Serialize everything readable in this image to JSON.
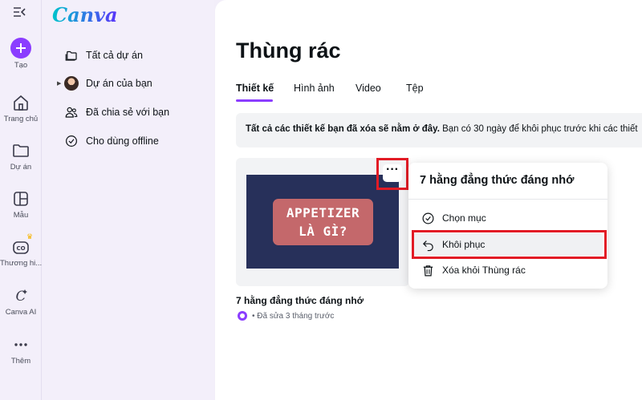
{
  "rail": {
    "items": [
      {
        "label": "Tạo",
        "icon": "plus-icon"
      },
      {
        "label": "Trang chủ",
        "icon": "home-icon"
      },
      {
        "label": "Dự án",
        "icon": "folder-icon"
      },
      {
        "label": "Mẫu",
        "icon": "template-icon"
      },
      {
        "label": "Thương hi...",
        "icon": "brand-icon"
      },
      {
        "label": "Canva AI",
        "icon": "canva-ai-icon"
      },
      {
        "label": "Thêm",
        "icon": "more-icon"
      }
    ]
  },
  "panel": {
    "logo": "Canva",
    "items": [
      {
        "label": "Tất cả dự án"
      },
      {
        "label": "Dự án của bạn"
      },
      {
        "label": "Đã chia sẻ với bạn"
      },
      {
        "label": "Cho dùng offline"
      }
    ]
  },
  "main": {
    "title": "Thùng rác",
    "tabs": [
      {
        "label": "Thiết kế"
      },
      {
        "label": "Hình ảnh"
      },
      {
        "label": "Video"
      },
      {
        "label": "Tệp"
      }
    ],
    "banner": {
      "bold": "Tất cả các thiết kế bạn đã xóa sẽ nằm ở đây.",
      "rest": " Bạn có 30 ngày để khôi phục trước khi các thiết"
    },
    "card": {
      "thumb_line1": "APPETIZER",
      "thumb_line2": "LÀ GÌ?",
      "more": "···",
      "title": "7 hằng đẳng thức đáng nhớ",
      "meta": "• Đã sửa 3 tháng trước"
    }
  },
  "menu": {
    "title": "7 hằng đẳng thức đáng nhớ",
    "items": [
      {
        "label": "Chọn mục",
        "icon": "check-circle-icon"
      },
      {
        "label": "Khôi phục",
        "icon": "undo-icon"
      },
      {
        "label": "Xóa khỏi Thùng rác",
        "icon": "trash-icon"
      }
    ]
  },
  "colors": {
    "accent": "#8b3dff",
    "highlight": "#e21b25",
    "thumb_bg": "#27305a",
    "thumb_box": "#c4686b"
  }
}
